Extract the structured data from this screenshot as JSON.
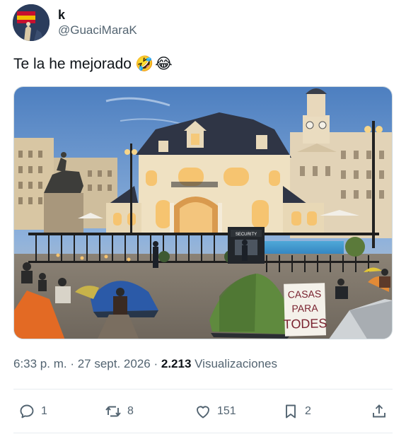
{
  "author": {
    "display_name": "k",
    "handle": "@GuaciMaraK",
    "avatar_icon": "avatar-photo"
  },
  "tweet": {
    "text": "Te la he mejorado",
    "emojis": [
      "🤣",
      "😂"
    ]
  },
  "media": {
    "sign_text_lines": [
      "CASAS",
      "PARA",
      "TODES"
    ],
    "security_label": "SECURITY"
  },
  "meta": {
    "time": "6:33 p. m.",
    "separator": " · ",
    "date": "27 sept. 2026",
    "views_count": "2.213",
    "views_label": "Visualizaciones"
  },
  "actions": {
    "reply_count": "1",
    "retweet_count": "8",
    "like_count": "151",
    "bookmark_count": "2",
    "icons": [
      "reply-icon",
      "retweet-icon",
      "like-icon",
      "bookmark-icon",
      "share-icon"
    ]
  },
  "colors": {
    "text_primary": "#0f1419",
    "text_secondary": "#536471",
    "divider": "#e7ecf0"
  }
}
